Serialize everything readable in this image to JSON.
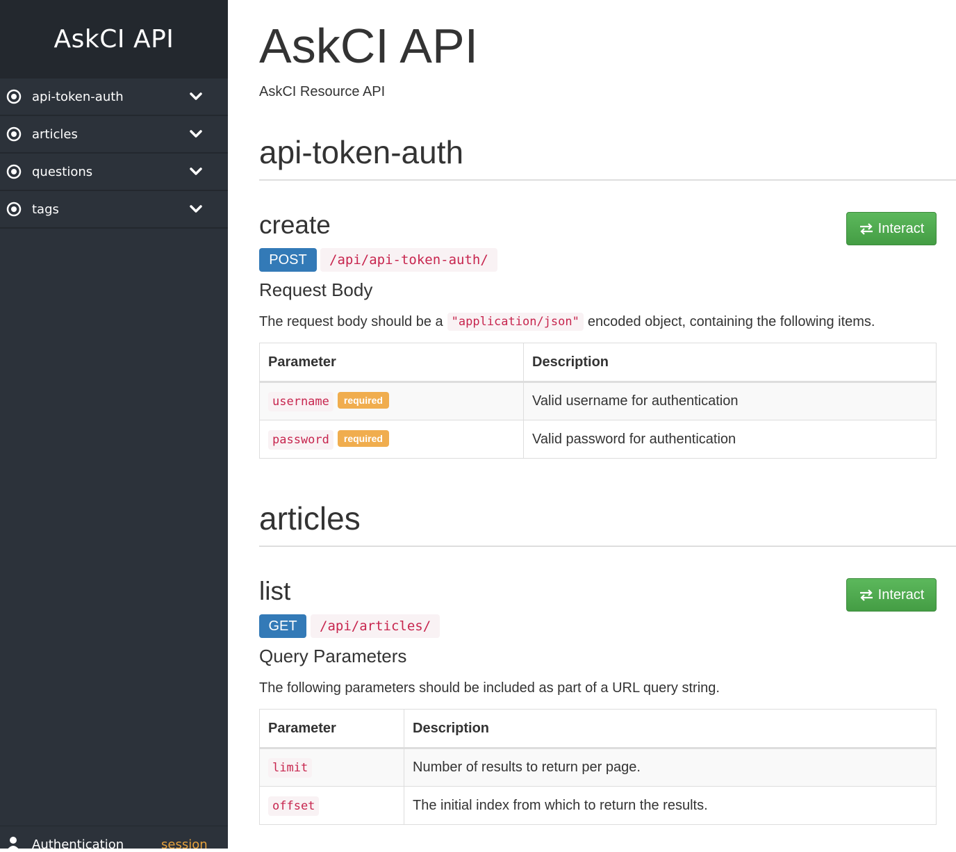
{
  "sidebar": {
    "brand": "AskCI API",
    "items": [
      {
        "label": "api-token-auth"
      },
      {
        "label": "articles"
      },
      {
        "label": "questions"
      },
      {
        "label": "tags"
      }
    ],
    "footer": {
      "auth_label": "Authentication",
      "auth_value": "session"
    }
  },
  "main": {
    "title": "AskCI API",
    "description": "AskCI Resource API",
    "sections": [
      {
        "title": "api-token-auth",
        "endpoint": {
          "name": "create",
          "method": "POST",
          "path": "/api/api-token-auth/",
          "interact_label": "Interact",
          "subheading": "Request Body",
          "para_before": "The request body should be a",
          "para_code": "\"application/json\"",
          "para_after": "encoded object, containing the following items.",
          "table": {
            "headers": [
              "Parameter",
              "Description"
            ],
            "rows": [
              {
                "param": "username",
                "badge": "required",
                "desc": "Valid username for authentication"
              },
              {
                "param": "password",
                "badge": "required",
                "desc": "Valid password for authentication"
              }
            ]
          }
        }
      },
      {
        "title": "articles",
        "endpoint": {
          "name": "list",
          "method": "GET",
          "path": "/api/articles/",
          "interact_label": "Interact",
          "subheading": "Query Parameters",
          "para": "The following parameters should be included as part of a URL query string.",
          "table": {
            "headers": [
              "Parameter",
              "Description"
            ],
            "rows": [
              {
                "param": "limit",
                "desc": "Number of results to return per page."
              },
              {
                "param": "offset",
                "desc": "The initial index from which to return the results."
              }
            ]
          }
        }
      }
    ]
  },
  "colors": {
    "sidebar_bg": "#2c323a",
    "brand_bg": "#23282e",
    "method_blue": "#337ab7",
    "interact_green": "#5cb85c",
    "required_orange": "#f0ad4e",
    "code_red": "#c7254e",
    "session_orange": "#e6a23c"
  },
  "icons": {
    "menu_item": "radio-target-icon",
    "menu_toggle": "chevron-down-icon",
    "interact": "exchange-arrows-icon",
    "footer": "user-icon"
  }
}
